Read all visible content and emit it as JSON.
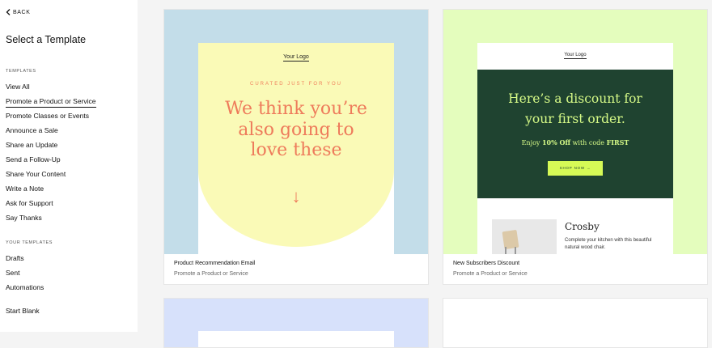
{
  "sidebar": {
    "back_label": "BACK",
    "title": "Select a Template",
    "templates_header": "TEMPLATES",
    "templates": [
      {
        "label": "View All"
      },
      {
        "label": "Promote a Product or Service"
      },
      {
        "label": "Promote Classes or Events"
      },
      {
        "label": "Announce a Sale"
      },
      {
        "label": "Share an Update"
      },
      {
        "label": "Send a Follow-Up"
      },
      {
        "label": "Share Your Content"
      },
      {
        "label": "Write a Note"
      },
      {
        "label": "Ask for Support"
      },
      {
        "label": "Say Thanks"
      }
    ],
    "active_template": "Promote a Product or Service",
    "your_templates_header": "YOUR TEMPLATES",
    "your_templates": [
      {
        "label": "Drafts"
      },
      {
        "label": "Sent"
      },
      {
        "label": "Automations"
      }
    ],
    "start_blank": "Start Blank"
  },
  "cards": [
    {
      "title": "Product Recommendation Email",
      "category": "Promote a Product or Service",
      "preview": {
        "logo": "Your Logo",
        "eyebrow": "CURATED JUST FOR YOU",
        "headline_lines": [
          "We think you’re",
          "also going to",
          "love these"
        ],
        "arrow": "↓",
        "bg_color": "#c3dde9",
        "accent_color": "#ee7b5b"
      }
    },
    {
      "title": "New Subscribers Discount",
      "category": "Promote a Product or Service",
      "preview": {
        "logo": "Your Logo",
        "headline_lines": [
          "Here’s a discount for",
          "your first order."
        ],
        "offer_prefix": "Enjoy ",
        "offer_amount": "10% Off",
        "offer_middle": " with code ",
        "offer_code": "FIRST",
        "cta": "SHOP NOW →",
        "product_name": "Crosby",
        "product_desc": "Complete your kitchen with this beautiful natural wood chair.",
        "bg_color": "#e4fdbd",
        "panel_color": "#1f4330"
      }
    }
  ]
}
